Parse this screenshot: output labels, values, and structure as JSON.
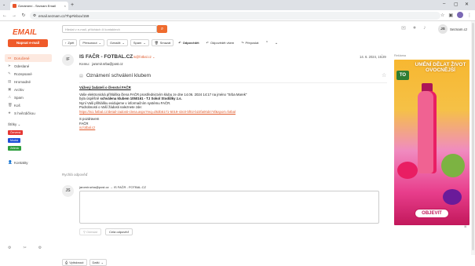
{
  "browser": {
    "tab_title": "Oznámení - Seznam Email",
    "tab_close": "×",
    "new_tab": "+",
    "url": "email.seznam.cz/?hp#inbox/159",
    "nav_back": "←",
    "nav_forward": "→",
    "nav_reload": "↻"
  },
  "header": {
    "logo_text": "EMAIL",
    "search_placeholder": "Hledat v e-mail, přílohách či kontaktech",
    "search_icon": "search-icon",
    "user_initials": "JS",
    "user_name": "Seznam.cz"
  },
  "sidebar": {
    "compose_label": "Napsat e-mail",
    "items": [
      {
        "label": "Doručené",
        "icon": "inbox-icon",
        "glyph": "▭",
        "active": true
      },
      {
        "label": "Odeslané",
        "icon": "send-icon",
        "glyph": "➤",
        "active": false
      },
      {
        "label": "Rozepsané",
        "icon": "draft-icon",
        "glyph": "✎",
        "active": false
      },
      {
        "label": "Hromadné",
        "icon": "bulk-icon",
        "glyph": "▤",
        "active": false
      },
      {
        "label": "Archiv",
        "icon": "archive-icon",
        "glyph": "▣",
        "active": false
      },
      {
        "label": "Spam",
        "icon": "spam-icon",
        "glyph": "⚠",
        "active": false
      },
      {
        "label": "Koš",
        "icon": "trash-icon",
        "glyph": "🗑",
        "active": false
      },
      {
        "label": "S hvězdičkou",
        "icon": "star-icon",
        "glyph": "★",
        "active": false
      }
    ],
    "labels_heading": "Štítky",
    "labels": [
      {
        "label": "Červená",
        "color": "#e53935"
      },
      {
        "label": "Modrá",
        "color": "#1e4fd8"
      },
      {
        "label": "Zelená",
        "color": "#2e9e3e"
      }
    ],
    "contacts_label": "Kontakty"
  },
  "toolbar": {
    "back": "Zpět",
    "move": "Přesunout",
    "mark": "Označit",
    "spam": "Spam",
    "delete": "Smazat",
    "reply": "Odpovědět",
    "reply_all": "Odpovědět všem",
    "forward": "Přeposlat"
  },
  "message": {
    "sender_initials": "IF",
    "sender_name": "IS FAČR - FOTBAL.CZ",
    "sender_email": "is@fotbal.cz",
    "to_label": "Komu:",
    "to_value": "jaromir.srba@post.cz",
    "date": "14. 6. 2024, 15:29",
    "subject": "Oznámení schválení klubem",
    "greeting": "Vážený žadateli o členství FAČR",
    "line1": "Vaše elektronická přihláška člena FAČR prostřednictvím klubu ze dne 14.06. 2024 14:17 na jméno \"Srba Marek\"",
    "line2_prefix": "byla úspěšně ",
    "line2_bold": "schválena klubem 1050161 - TJ Sokol Stodůlky z.s.",
    "line3": "Nyní Vaši přihlášku evidujeme v informačním systému FAČR.",
    "line4": "Podrobnosti o Vaší žádosti naleznete zde:",
    "link": "https://is1.fotbal.cz/detail-zadosti-clena.aspx?req=d63b5171-5019-43c0-bf02-b22fa00d474f&sport=fotbal",
    "sign1": "S pozdravem",
    "sign2": "FAČR",
    "sign_link": "is.fotbal.cz"
  },
  "reply": {
    "title": "Rychlá odpověď",
    "initials": "JS",
    "from_to": "jaromir.srba@post.cz → IS FAČR - FOTBAL.CZ",
    "send": "Odeslat",
    "full": "Celá odpověď"
  },
  "bottom": {
    "compose_btn": "Vytisknout",
    "more": "Další"
  },
  "ad": {
    "label": "Reklama",
    "headline": "UMĚNÍ DĚLAT ŽIVOT OVOCNĚJŠÍ",
    "brand": "TO",
    "cta": "OBJEVIT"
  },
  "colors": {
    "accent": "#ef5a2a",
    "link": "#e05a2b"
  }
}
